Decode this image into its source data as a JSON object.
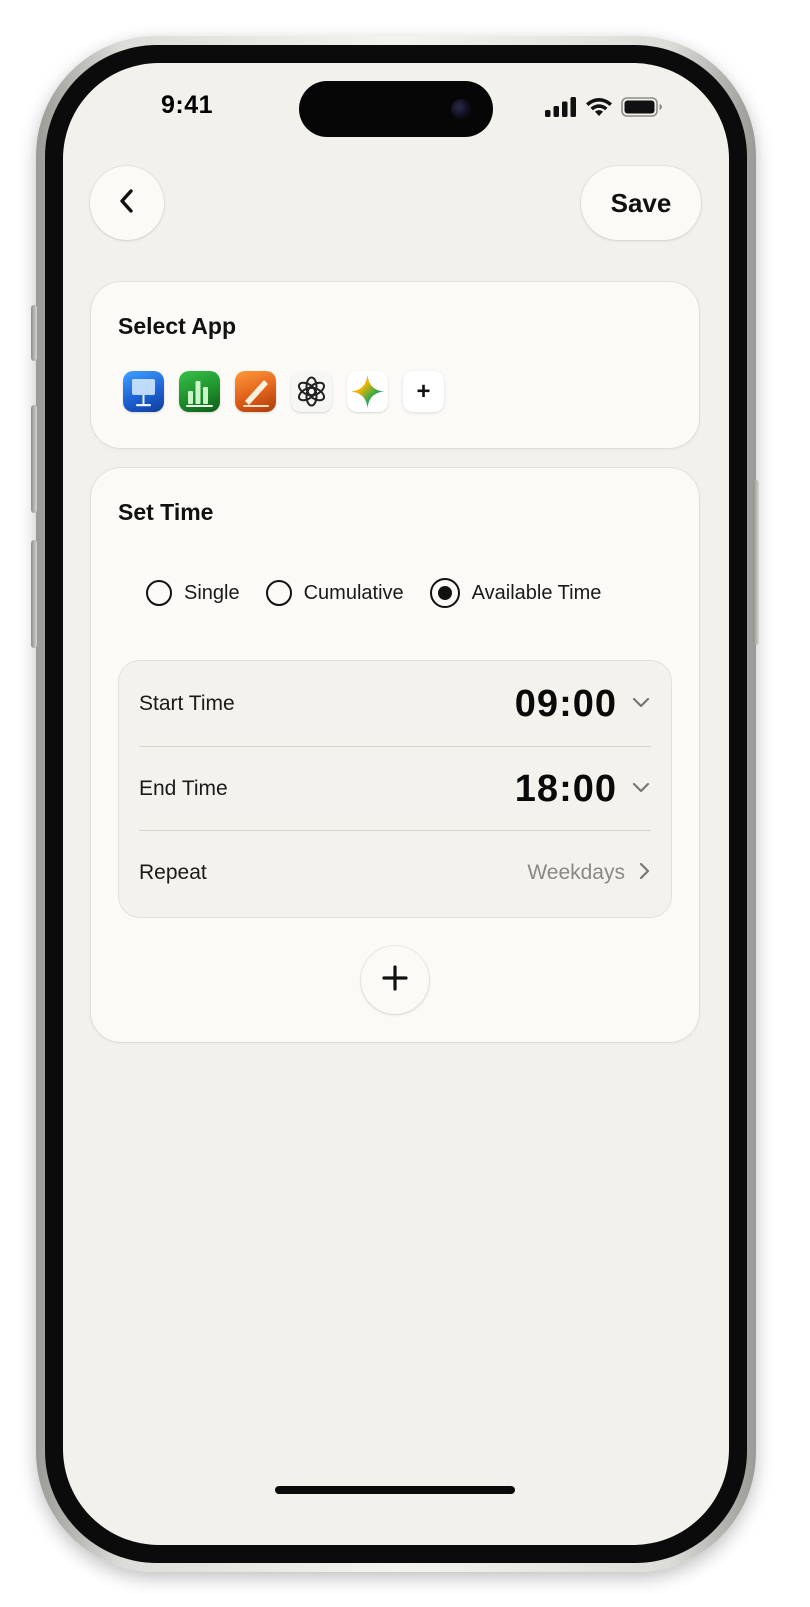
{
  "status_bar": {
    "time": "9:41"
  },
  "header": {
    "back_icon": "chevron-left-icon",
    "save_label": "Save"
  },
  "select_app": {
    "title": "Select App",
    "apps": [
      {
        "name": "keynote-app-icon"
      },
      {
        "name": "numbers-app-icon"
      },
      {
        "name": "pages-app-icon"
      },
      {
        "name": "chatgpt-app-icon"
      },
      {
        "name": "gemini-app-icon"
      }
    ],
    "add_label": "+"
  },
  "set_time": {
    "title": "Set Time",
    "modes": [
      {
        "label": "Single",
        "selected": false
      },
      {
        "label": "Cumulative",
        "selected": false
      },
      {
        "label": "Available Time",
        "selected": true
      }
    ],
    "start_label": "Start Time",
    "start_value": "09:00",
    "end_label": "End Time",
    "end_value": "18:00",
    "repeat_label": "Repeat",
    "repeat_value": "Weekdays"
  },
  "colors": {
    "background": "#f3f1ec",
    "card": "#fbfaf7",
    "muted_text": "#8b8985"
  }
}
